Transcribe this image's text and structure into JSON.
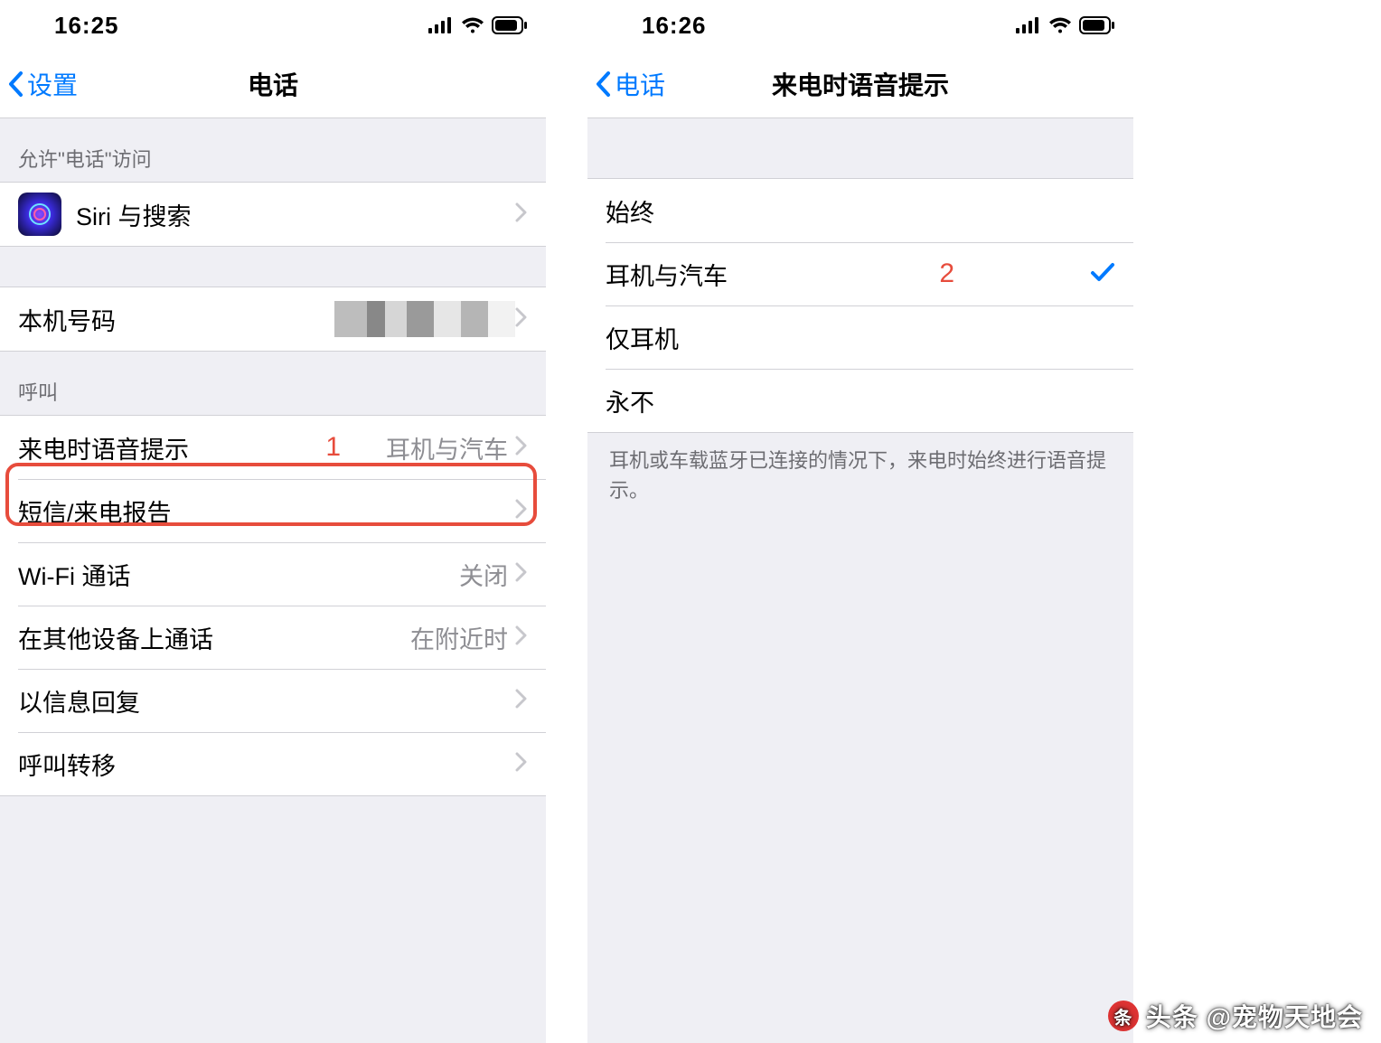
{
  "left": {
    "status_time": "16:25",
    "nav_back": "设置",
    "nav_title": "电话",
    "group1_header": "允许\"电话\"访问",
    "siri_label": "Siri 与搜索",
    "my_number_label": "本机号码",
    "group3_header": "呼叫",
    "row_announce_label": "来电时语音提示",
    "row_announce_value": "耳机与汽车",
    "row_sms_label": "短信/来电报告",
    "row_wifi_label": "Wi-Fi 通话",
    "row_wifi_value": "关闭",
    "row_other_label": "在其他设备上通话",
    "row_other_value": "在附近时",
    "row_reply_label": "以信息回复",
    "row_forward_label": "呼叫转移",
    "annotation": "1"
  },
  "right": {
    "status_time": "16:26",
    "nav_back": "电话",
    "nav_title": "来电时语音提示",
    "opt_always": "始终",
    "opt_headphones_car": "耳机与汽车",
    "opt_headphones_only": "仅耳机",
    "opt_never": "永不",
    "footer": "耳机或车载蓝牙已连接的情况下，来电时始终进行语音提示。",
    "annotation": "2"
  },
  "watermark": "头条 @宠物天地会"
}
